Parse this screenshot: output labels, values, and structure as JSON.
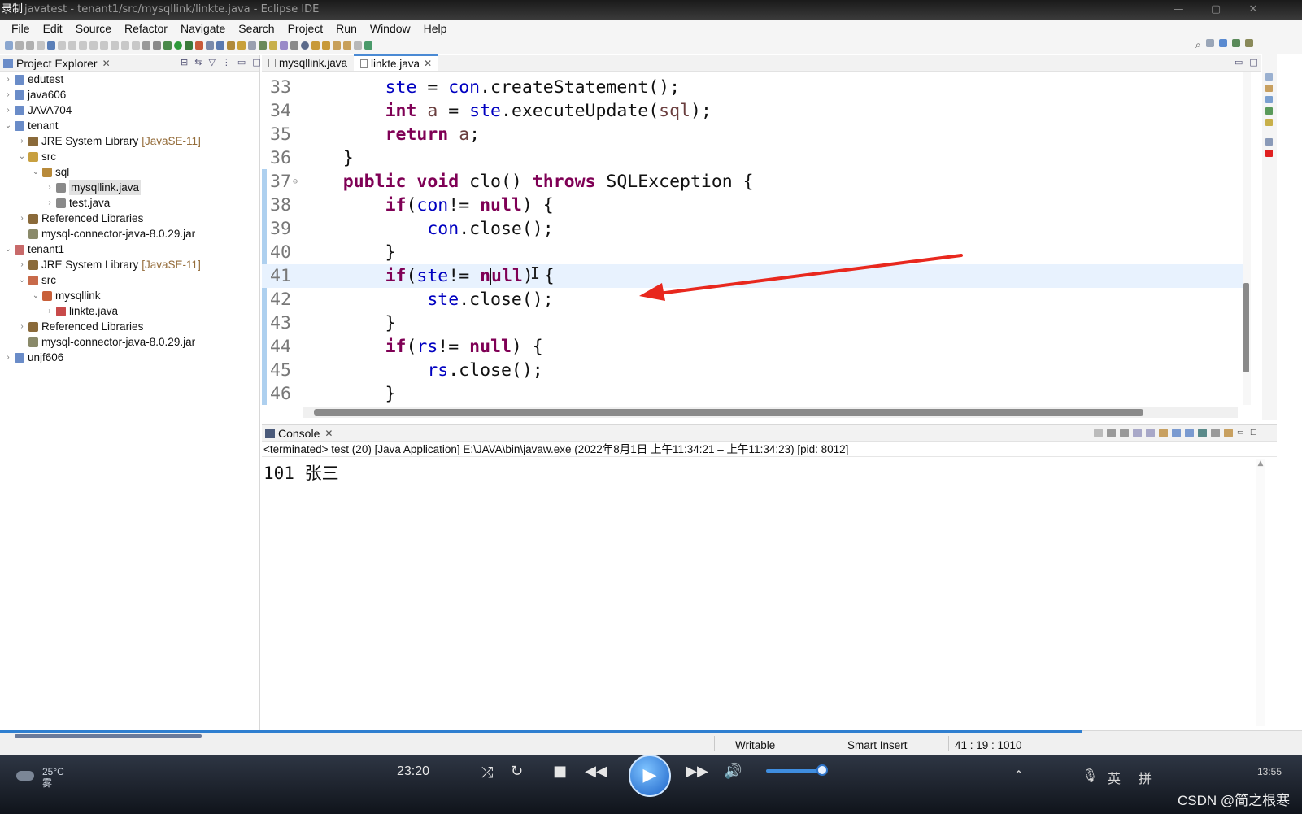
{
  "window": {
    "recorder_label": "录制",
    "title": "javatest - tenant1/src/mysqllink/linkte.java - Eclipse IDE"
  },
  "menu": [
    "File",
    "Edit",
    "Source",
    "Refactor",
    "Navigate",
    "Search",
    "Project",
    "Run",
    "Window",
    "Help"
  ],
  "explorer": {
    "title": "Project Explorer",
    "items": [
      {
        "label": "edutest",
        "depth": 0,
        "twisty": "›",
        "icon": "project-icon",
        "color": "#6a8cc8"
      },
      {
        "label": "java606",
        "depth": 0,
        "twisty": "›",
        "icon": "project-icon",
        "color": "#6a8cc8"
      },
      {
        "label": "JAVA704",
        "depth": 0,
        "twisty": "›",
        "icon": "project-icon",
        "color": "#6a8cc8"
      },
      {
        "label": "tenant",
        "depth": 0,
        "twisty": "⌄",
        "icon": "project-icon",
        "color": "#6a8cc8"
      },
      {
        "label": "JRE System Library",
        "deco": "[JavaSE-11]",
        "depth": 1,
        "twisty": "›",
        "icon": "library-icon",
        "color": "#8a6a3a"
      },
      {
        "label": "src",
        "depth": 1,
        "twisty": "⌄",
        "icon": "source-folder-icon",
        "color": "#c8a040"
      },
      {
        "label": "sql",
        "depth": 2,
        "twisty": "⌄",
        "icon": "package-icon",
        "color": "#b88a3a"
      },
      {
        "label": "mysqllink.java",
        "depth": 3,
        "twisty": "›",
        "icon": "java-file-icon",
        "color": "#8a8a8a",
        "selected": true
      },
      {
        "label": "test.java",
        "depth": 3,
        "twisty": "›",
        "icon": "java-file-icon",
        "color": "#8a8a8a"
      },
      {
        "label": "Referenced Libraries",
        "depth": 1,
        "twisty": "›",
        "icon": "library-icon",
        "color": "#8a6a3a"
      },
      {
        "label": "mysql-connector-java-8.0.29.jar",
        "depth": 1,
        "twisty": "",
        "icon": "jar-icon",
        "color": "#8a8a6a"
      },
      {
        "label": "tenant1",
        "depth": 0,
        "twisty": "⌄",
        "icon": "project-icon",
        "color": "#c86a6a"
      },
      {
        "label": "JRE System Library",
        "deco": "[JavaSE-11]",
        "depth": 1,
        "twisty": "›",
        "icon": "library-icon",
        "color": "#8a6a3a"
      },
      {
        "label": "src",
        "depth": 1,
        "twisty": "⌄",
        "icon": "source-folder-icon",
        "color": "#c86a4a"
      },
      {
        "label": "mysqllink",
        "depth": 2,
        "twisty": "⌄",
        "icon": "package-icon",
        "color": "#c8603a"
      },
      {
        "label": "linkte.java",
        "depth": 3,
        "twisty": "›",
        "icon": "java-file-icon",
        "color": "#c84a4a"
      },
      {
        "label": "Referenced Libraries",
        "depth": 1,
        "twisty": "›",
        "icon": "library-icon",
        "color": "#8a6a3a"
      },
      {
        "label": "mysql-connector-java-8.0.29.jar",
        "depth": 1,
        "twisty": "",
        "icon": "jar-icon",
        "color": "#8a8a6a"
      },
      {
        "label": "unjf606",
        "depth": 0,
        "twisty": "›",
        "icon": "project-icon",
        "color": "#6a8cc8"
      }
    ]
  },
  "editor": {
    "tabs": [
      {
        "label": "mysqllink.java",
        "active": false
      },
      {
        "label": "linkte.java",
        "active": true
      }
    ],
    "lines": [
      {
        "n": "33",
        "tokens": [
          [
            "",
            "        "
          ],
          [
            "fd",
            "ste"
          ],
          [
            "",
            " = "
          ],
          [
            "fd",
            "con"
          ],
          [
            "",
            ".createStatement();"
          ]
        ]
      },
      {
        "n": "34",
        "tokens": [
          [
            "",
            "        "
          ],
          [
            "kw",
            "int"
          ],
          [
            "",
            " "
          ],
          [
            "lv",
            "a"
          ],
          [
            "",
            " = "
          ],
          [
            "fd",
            "ste"
          ],
          [
            "",
            ".executeUpdate("
          ],
          [
            "lv",
            "sql"
          ],
          [
            "",
            ");"
          ]
        ]
      },
      {
        "n": "35",
        "tokens": [
          [
            "",
            "        "
          ],
          [
            "kw",
            "return"
          ],
          [
            "",
            " "
          ],
          [
            "lv",
            "a"
          ],
          [
            "",
            ";"
          ]
        ]
      },
      {
        "n": "36",
        "tokens": [
          [
            "",
            "    }"
          ]
        ]
      },
      {
        "n": "37",
        "fold": "⊖",
        "tokens": [
          [
            "",
            "    "
          ],
          [
            "kw",
            "public"
          ],
          [
            "",
            " "
          ],
          [
            "kw",
            "void"
          ],
          [
            "",
            " clo() "
          ],
          [
            "kw",
            "throws"
          ],
          [
            "",
            " SQLException {"
          ]
        ]
      },
      {
        "n": "38",
        "tokens": [
          [
            "",
            "        "
          ],
          [
            "kw",
            "if"
          ],
          [
            "",
            "("
          ],
          [
            "fd",
            "con"
          ],
          [
            "",
            "!= "
          ],
          [
            "kw",
            "null"
          ],
          [
            "",
            ") {"
          ]
        ]
      },
      {
        "n": "39",
        "tokens": [
          [
            "",
            "            "
          ],
          [
            "fd",
            "con"
          ],
          [
            "",
            ".close();"
          ]
        ]
      },
      {
        "n": "40",
        "tokens": [
          [
            "",
            "        }"
          ]
        ]
      },
      {
        "n": "41",
        "current": true,
        "tokens": [
          [
            "",
            "        "
          ],
          [
            "kw",
            "if"
          ],
          [
            "",
            "("
          ],
          [
            "fd",
            "ste"
          ],
          [
            "",
            "!= "
          ],
          [
            "kw",
            "n"
          ],
          [
            "caret",
            ""
          ],
          [
            "kw",
            "ull"
          ],
          [
            "",
            ") {"
          ]
        ]
      },
      {
        "n": "42",
        "tokens": [
          [
            "",
            "            "
          ],
          [
            "fd",
            "ste"
          ],
          [
            "",
            ".close();"
          ]
        ]
      },
      {
        "n": "43",
        "tokens": [
          [
            "",
            "        }"
          ]
        ]
      },
      {
        "n": "44",
        "tokens": [
          [
            "",
            "        "
          ],
          [
            "kw",
            "if"
          ],
          [
            "",
            "("
          ],
          [
            "fd",
            "rs"
          ],
          [
            "",
            "!= "
          ],
          [
            "kw",
            "null"
          ],
          [
            "",
            ") {"
          ]
        ]
      },
      {
        "n": "45",
        "tokens": [
          [
            "",
            "            "
          ],
          [
            "fd",
            "rs"
          ],
          [
            "",
            ".close();"
          ]
        ]
      },
      {
        "n": "46",
        "tokens": [
          [
            "",
            "        }"
          ]
        ]
      }
    ]
  },
  "console": {
    "title": "Console",
    "terminated": "<terminated> test (20) [Java Application] E:\\JAVA\\bin\\javaw.exe  (2022年8月1日 上午11:34:21 – 上午11:34:23) [pid: 8012]",
    "output": "101 张三"
  },
  "status": {
    "writable": "Writable",
    "insert_mode": "Smart Insert",
    "position": "41 : 19 : 1010"
  },
  "taskbar": {
    "temperature": "25°C",
    "weather": "雾",
    "player_time": "23:20",
    "ime_en": "英",
    "ime_pinyin": "拼",
    "clock": "13:55",
    "watermark": "CSDN @简之根寒"
  },
  "colors": {
    "keyword": "#7f0055",
    "field": "#0000c0",
    "local_var": "#6a3e3e",
    "current_line": "#e8f2fe",
    "annotation_arrow": "#e8281e"
  }
}
